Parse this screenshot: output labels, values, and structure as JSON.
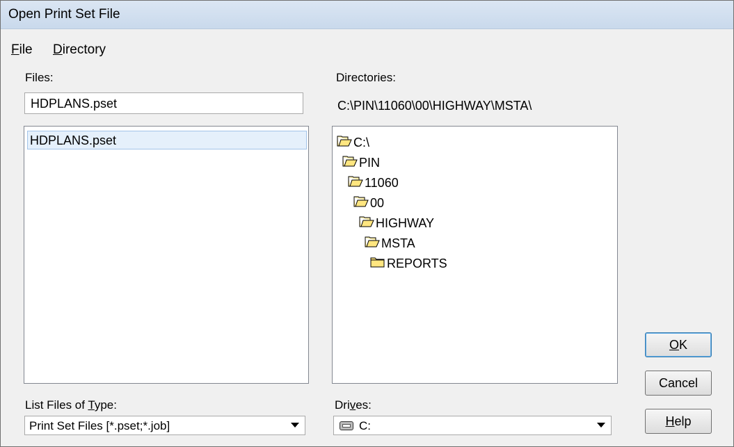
{
  "window": {
    "title": "Open Print Set File"
  },
  "menu": [
    {
      "label": "File"
    },
    {
      "label": "Directory"
    }
  ],
  "files": {
    "label": "Files:",
    "input_value": "HDPLANS.pset",
    "items": [
      "HDPLANS.pset"
    ]
  },
  "directories": {
    "label": "Directories:",
    "current_path": "C:\\PIN\\11060\\00\\HIGHWAY\\MSTA\\",
    "tree": [
      "C:\\",
      "PIN",
      "11060",
      "00",
      "HIGHWAY",
      "MSTA",
      "REPORTS"
    ]
  },
  "file_type": {
    "label": "List Files of Type:",
    "value": "Print Set Files [*.pset;*.job]"
  },
  "drives": {
    "label": "Drives:",
    "value": "C:"
  },
  "buttons": {
    "ok": "OK",
    "cancel": "Cancel",
    "help": "Help"
  },
  "icons": {
    "open_folder": "open-folder-icon",
    "closed_folder": "folder-icon",
    "drive": "drive-icon"
  }
}
